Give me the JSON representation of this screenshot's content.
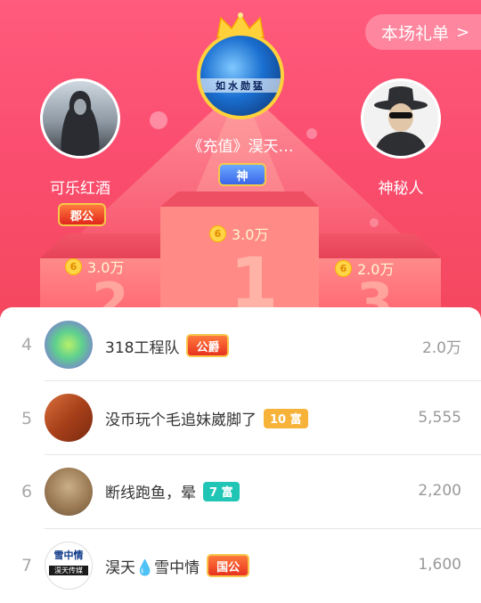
{
  "header": {
    "gift_list_label": "本场礼单"
  },
  "podium": [
    {
      "position": "1",
      "name": "《充值》淏天…",
      "badge": "神",
      "score": "3.0万",
      "avatar_text": "如水勋猛"
    },
    {
      "position": "2",
      "name": "可乐红酒",
      "badge": "郡公",
      "score": "3.0万"
    },
    {
      "position": "3",
      "name": "神秘人",
      "score": "2.0万"
    }
  ],
  "coin_symbol": "6",
  "ranking": [
    {
      "rank": "4",
      "name": "318工程队",
      "badge": "公爵",
      "value": "2.0万"
    },
    {
      "rank": "5",
      "name": "没币玩个毛追妹崴脚了",
      "level": "10 富",
      "value": "5,555"
    },
    {
      "rank": "6",
      "name": "断线跑鱼，晕",
      "level": "7 富",
      "value": "2,200"
    },
    {
      "rank": "7",
      "name": "淏天💧雪中情",
      "badge": "国公",
      "value": "1,600",
      "avatar_text_top": "雪中情",
      "avatar_text_bottom": "淏天传媒"
    }
  ],
  "colors": {
    "background_top": "#ff5b7c",
    "level_orange": "#f7b23a",
    "level_teal": "#20c5b5"
  }
}
